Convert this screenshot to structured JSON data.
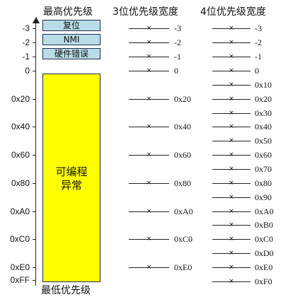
{
  "headers": {
    "highest_priority": "最高优先级",
    "bits3_column": "3位优先级宽度",
    "bits4_column": "4位优先级宽度",
    "lowest_priority": "最低优先级"
  },
  "axis": {
    "labels": [
      "-3",
      "-2",
      "-1",
      "0",
      "0x20",
      "0x40",
      "0x60",
      "0x80",
      "0xA0",
      "0xC0",
      "0xE0",
      "0xFF"
    ]
  },
  "fixed_exceptions": [
    {
      "label": "复位",
      "priority": "-3"
    },
    {
      "label": "NMI",
      "priority": "-2"
    },
    {
      "label": "硬件错误",
      "priority": "-1"
    }
  ],
  "programmable_region": {
    "label_line1": "可编程",
    "label_line2": "异常",
    "color": "#ffff00"
  },
  "fixed_box_color": "#b7dde8",
  "bits3_levels": [
    "-3",
    "-2",
    "-1",
    "0",
    "0x20",
    "0x40",
    "0x60",
    "0x80",
    "0xA0",
    "0xC0",
    "0xE0"
  ],
  "bits4_levels": [
    "-3",
    "-2",
    "-1",
    "0",
    "0x10",
    "0x20",
    "0x30",
    "0x40",
    "0x50",
    "0x60",
    "0x70",
    "0x80",
    "0x90",
    "0xA0",
    "0xB0",
    "0xC0",
    "0xD0",
    "0xE0",
    "0xF0"
  ],
  "marker_glyph": "×"
}
